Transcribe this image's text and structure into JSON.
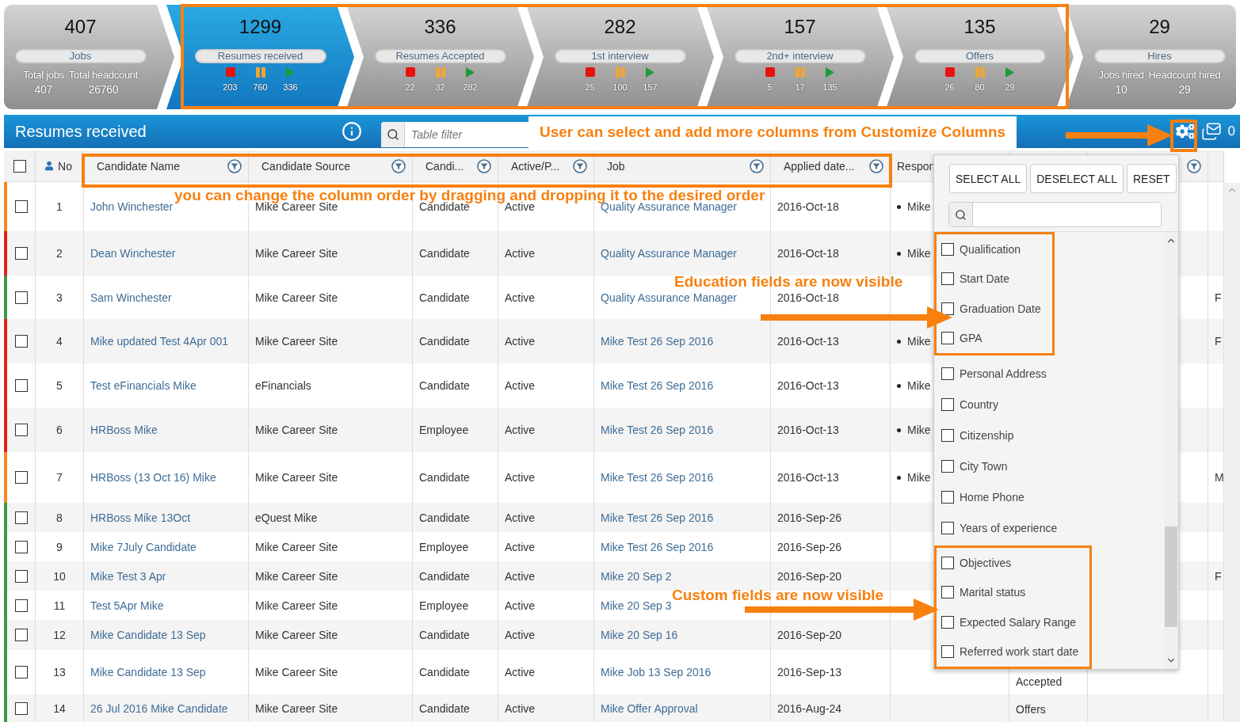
{
  "pipeline": {
    "stages": [
      {
        "kind": "summary",
        "count": "407",
        "label": "Jobs",
        "selected": false,
        "stats": [
          {
            "label": "Total jobs",
            "value": "407"
          },
          {
            "label": "Total headcount",
            "value": "26760"
          }
        ]
      },
      {
        "kind": "flow",
        "count": "1299",
        "label": "Resumes received",
        "selected": true,
        "counts": [
          "203",
          "760",
          "336"
        ]
      },
      {
        "kind": "flow",
        "count": "336",
        "label": "Resumes Accepted",
        "selected": false,
        "counts": [
          "22",
          "32",
          "282"
        ]
      },
      {
        "kind": "flow",
        "count": "282",
        "label": "1st interview",
        "selected": false,
        "counts": [
          "25",
          "100",
          "157"
        ]
      },
      {
        "kind": "flow",
        "count": "157",
        "label": "2nd+ interview",
        "selected": false,
        "counts": [
          "5",
          "17",
          "135"
        ]
      },
      {
        "kind": "flow",
        "count": "135",
        "label": "Offers",
        "selected": false,
        "counts": [
          "26",
          "80",
          "29"
        ]
      },
      {
        "kind": "summary",
        "count": "29",
        "label": "Hires",
        "selected": false,
        "stats": [
          {
            "label": "Jobs hired",
            "value": "10"
          },
          {
            "label": "Headcount hired",
            "value": "29"
          }
        ]
      }
    ]
  },
  "panel": {
    "title": "Resumes received",
    "filter_placeholder": "Table filter",
    "message_count": "0"
  },
  "table": {
    "select_all_checked": false,
    "columns": [
      {
        "label": "No",
        "filter": false
      },
      {
        "label": "Candidate Name",
        "filter": true
      },
      {
        "label": "Candidate Source",
        "filter": true
      },
      {
        "label": "Candi...",
        "filter": true
      },
      {
        "label": "Active/P...",
        "filter": true
      },
      {
        "label": "Job",
        "filter": true
      },
      {
        "label": "Applied date...",
        "filter": true
      },
      {
        "label": "Respon"
      },
      {},
      {
        "filter": true
      },
      {}
    ],
    "rows": [
      {
        "checked": false,
        "color": "#f7861e",
        "no": "1",
        "name": "John Winchester",
        "source": "Mike Career Site",
        "type": "Candidate",
        "status": "Active",
        "job": "Quality Assurance Manager",
        "applied": "2016-Oct-18",
        "responsible": "Mike"
      },
      {
        "checked": false,
        "color": "#e2211c",
        "no": "2",
        "name": "Dean Winchester",
        "source": "Mike Career Site",
        "type": "Candidate",
        "status": "Active",
        "job": "Quality Assurance Manager",
        "applied": "2016-Oct-18",
        "responsible": "Mike"
      },
      {
        "checked": false,
        "color": "#3a9a47",
        "no": "3",
        "name": "Sam Winchester",
        "source": "Mike Career Site",
        "type": "Candidate",
        "status": "Active",
        "job": "Quality Assurance Manager",
        "applied": "2016-Oct-18",
        "column_12": "F"
      },
      {
        "checked": false,
        "color": "#e2211c",
        "no": "4",
        "name": "Mike updated Test 4Apr 001",
        "source": "Mike Career Site",
        "type": "Candidate",
        "status": "Active",
        "job": "Mike Test 26 Sep 2016",
        "applied": "2016-Oct-13",
        "responsible": "Mike",
        "column_12": "F"
      },
      {
        "checked": false,
        "color": "#e2211c",
        "no": "5",
        "name": "Test eFinancials Mike",
        "source": "eFinancials",
        "type": "Candidate",
        "status": "Active",
        "job": "Mike Test 26 Sep 2016",
        "applied": "2016-Oct-13",
        "responsible": "Mike"
      },
      {
        "checked": false,
        "color": "#e2211c",
        "no": "6",
        "name": "HRBoss Mike",
        "source": "Mike Career Site",
        "type": "Employee",
        "status": "Active",
        "job": "Mike Test 26 Sep 2016",
        "applied": "2016-Oct-13",
        "responsible": "Mike"
      },
      {
        "checked": false,
        "color": "#f7861e",
        "no": "7",
        "name": "HRBoss (13 Oct 16) Mike",
        "source": "Mike Career Site",
        "type": "Candidate",
        "status": "Active",
        "job": "Mike Test 26 Sep 2016",
        "applied": "2016-Oct-13",
        "responsible": "Mike",
        "column_12": "M"
      },
      {
        "checked": false,
        "color": "#3a9a47",
        "no": "8",
        "name": "HRBoss Mike 13Oct",
        "source": "eQuest Mike",
        "type": "Candidate",
        "status": "Active",
        "job": "Mike Test 26 Sep 2016",
        "applied": "2016-Sep-26"
      },
      {
        "checked": false,
        "color": "#3a9a47",
        "no": "9",
        "name": "Mike 7July Candidate",
        "source": "Mike Career Site",
        "type": "Employee",
        "status": "Active",
        "job": "Mike Test 26 Sep 2016",
        "applied": "2016-Sep-26"
      },
      {
        "checked": false,
        "color": "#3a9a47",
        "no": "10",
        "name": "Mike Test 3 Apr",
        "source": "Mike Career Site",
        "type": "Candidate",
        "status": "Active",
        "job": "Mike 20 Sep 2",
        "applied": "2016-Sep-20",
        "column_12": "F"
      },
      {
        "checked": false,
        "color": "#3a9a47",
        "no": "11",
        "name": "Test 5Apr Mike",
        "source": "Mike Career Site",
        "type": "Employee",
        "status": "Active",
        "job": "Mike 20 Sep 3"
      },
      {
        "checked": false,
        "color": "#3a9a47",
        "no": "12",
        "name": "Mike Candidate 13 Sep",
        "source": "Mike Career Site",
        "type": "Candidate",
        "status": "Active",
        "job": "Mike 20 Sep 16",
        "applied": "2016-Sep-20"
      },
      {
        "checked": false,
        "color": "#3a9a47",
        "no": "13",
        "name": "Mike Candidate 13 Sep",
        "source": "Mike Career Site",
        "type": "Candidate",
        "status": "Active",
        "job": "Mike Job 13 Sep 2016",
        "applied": "2016-Sep-13",
        "column_10": "Accepted"
      },
      {
        "checked": false,
        "color": "#3a9a47",
        "no": "14",
        "name": "26 Jul 2016 Mike Candidate",
        "source": "Mike Career Site",
        "type": "Candidate",
        "status": "Active",
        "job": "Mike Offer Approval",
        "applied": "2016-Aug-24",
        "column_10": "Offers"
      }
    ]
  },
  "column_picker": {
    "buttons": [
      "SELECT ALL",
      "DESELECT ALL",
      "RESET"
    ],
    "groups": [
      {
        "annotated": true,
        "items": [
          {
            "label": "Qualification",
            "checked": false
          },
          {
            "label": "Start Date",
            "checked": false
          },
          {
            "label": "Graduation Date",
            "checked": false
          },
          {
            "label": "GPA",
            "checked": false
          }
        ]
      },
      {
        "annotated": false,
        "items": [
          {
            "label": "Personal Address",
            "checked": false
          },
          {
            "label": "Country",
            "checked": false
          },
          {
            "label": "Citizenship",
            "checked": false
          },
          {
            "label": "City Town",
            "checked": false
          },
          {
            "label": "Home Phone",
            "checked": false
          },
          {
            "label": "Years of experience",
            "checked": false
          }
        ]
      },
      {
        "annotated": true,
        "items": [
          {
            "label": "Objectives",
            "checked": false
          },
          {
            "label": "Marital status",
            "checked": false
          },
          {
            "label": "Expected Salary Range",
            "checked": false
          },
          {
            "label": "Referred work start date",
            "checked": false
          }
        ]
      }
    ]
  },
  "annotations": [
    "User can select and add more columns from Customize Columns",
    "you can change the column order by dragging and dropping it to the desired order",
    "Education fields are now visible",
    "Custom fields are now visible"
  ]
}
